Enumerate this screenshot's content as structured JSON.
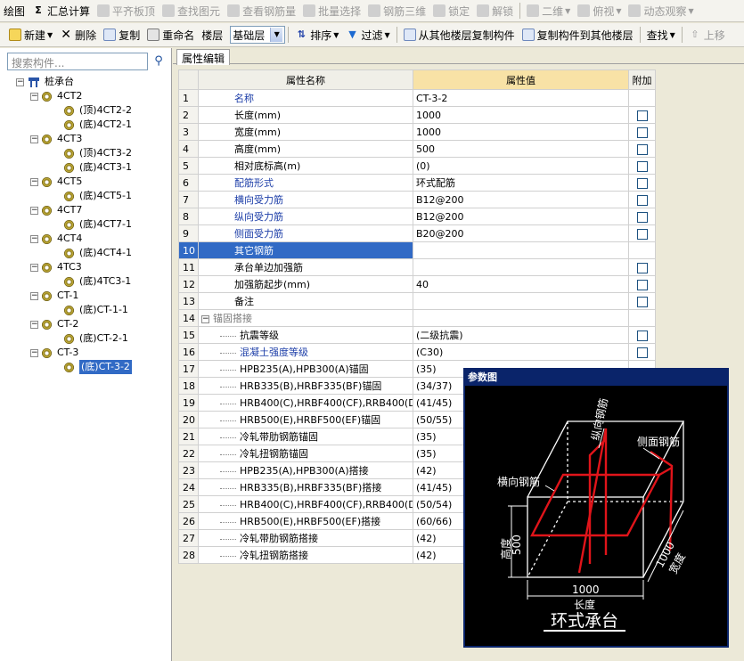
{
  "toolbar1": {
    "items": [
      {
        "label": "绘图",
        "enabled": true
      },
      {
        "label": "汇总计算",
        "enabled": true,
        "icon": "sigma-icon"
      },
      {
        "label": "平齐板顶",
        "enabled": false
      },
      {
        "label": "查找图元",
        "enabled": false
      },
      {
        "label": "查看钢筋量",
        "enabled": false
      },
      {
        "label": "批量选择",
        "enabled": false
      },
      {
        "label": "钢筋三维",
        "enabled": false
      },
      {
        "label": "锁定",
        "enabled": false
      },
      {
        "label": "解锁",
        "enabled": false
      },
      {
        "label": "二维",
        "enabled": false
      },
      {
        "label": "俯视",
        "enabled": false
      },
      {
        "label": "动态观察",
        "enabled": false
      }
    ]
  },
  "toolbar2": {
    "new_label": "新建",
    "delete_label": "删除",
    "copy_label": "复制",
    "rename_label": "重命名",
    "floor_label": "楼层",
    "floor_value": "基础层",
    "sort_label": "排序",
    "filter_label": "过滤",
    "copy_from_label": "从其他楼层复制构件",
    "copy_to_label": "复制构件到其他楼层",
    "find_label": "查找",
    "move_up_label": "上移"
  },
  "left": {
    "search_placeholder": "搜索构件...",
    "root": "桩承台",
    "groups": [
      {
        "name": "4CT2",
        "children": [
          "(顶)4CT2-2",
          "(底)4CT2-1"
        ]
      },
      {
        "name": "4CT3",
        "children": [
          "(顶)4CT3-2",
          "(底)4CT3-1"
        ]
      },
      {
        "name": "4CT5",
        "children": [
          "(底)4CT5-1"
        ]
      },
      {
        "name": "4CT7",
        "children": [
          "(底)4CT7-1"
        ]
      },
      {
        "name": "4CT4",
        "children": [
          "(底)4CT4-1"
        ]
      },
      {
        "name": "4TC3",
        "children": [
          "(底)4TC3-1"
        ]
      },
      {
        "name": "CT-1",
        "children": [
          "(底)CT-1-1"
        ]
      },
      {
        "name": "CT-2",
        "children": [
          "(底)CT-2-1"
        ]
      },
      {
        "name": "CT-3",
        "children": [
          "(底)CT-3-2"
        ]
      }
    ],
    "selected": "(底)CT-3-2"
  },
  "tab": {
    "label": "属性编辑"
  },
  "grid": {
    "headers": [
      "属性名称",
      "属性值",
      "附加"
    ],
    "rows": [
      {
        "n": "1",
        "name": "名称",
        "value": "CT-3-2",
        "style": "blue",
        "cb": false
      },
      {
        "n": "2",
        "name": "长度(mm)",
        "value": "1000",
        "style": "",
        "cb": true
      },
      {
        "n": "3",
        "name": "宽度(mm)",
        "value": "1000",
        "style": "",
        "cb": true
      },
      {
        "n": "4",
        "name": "高度(mm)",
        "value": "500",
        "style": "",
        "cb": true
      },
      {
        "n": "5",
        "name": "相对底标高(m)",
        "value": "(0)",
        "style": "",
        "cb": true
      },
      {
        "n": "6",
        "name": "配筋形式",
        "value": "环式配筋",
        "style": "blue",
        "cb": true
      },
      {
        "n": "7",
        "name": "横向受力筋",
        "value": "B12@200",
        "style": "blue",
        "cb": true
      },
      {
        "n": "8",
        "name": "纵向受力筋",
        "value": "B12@200",
        "style": "blue",
        "cb": true
      },
      {
        "n": "9",
        "name": "侧面受力筋",
        "value": "B20@200",
        "style": "blue",
        "cb": true
      },
      {
        "n": "10",
        "name": "其它钢筋",
        "value": "",
        "style": "selected",
        "cb": false
      },
      {
        "n": "11",
        "name": "承台单边加强筋",
        "value": "",
        "style": "",
        "cb": true
      },
      {
        "n": "12",
        "name": "加强筋起步(mm)",
        "value": "40",
        "style": "",
        "cb": true
      },
      {
        "n": "13",
        "name": "备注",
        "value": "",
        "style": "",
        "cb": true
      },
      {
        "n": "14",
        "name": "锚固搭接",
        "value": "",
        "style": "group",
        "cb": false
      },
      {
        "n": "15",
        "name": "抗震等级",
        "value": "(二级抗震)",
        "style": "sub",
        "cb": true
      },
      {
        "n": "16",
        "name": "混凝土强度等级",
        "value": "(C30)",
        "style": "sub-blue",
        "cb": true
      },
      {
        "n": "17",
        "name": "HPB235(A),HPB300(A)锚固",
        "value": "(35)",
        "style": "sub",
        "cb": false
      },
      {
        "n": "18",
        "name": "HRB335(B),HRBF335(BF)锚固",
        "value": "(34/37)",
        "style": "sub",
        "cb": false
      },
      {
        "n": "19",
        "name": "HRB400(C),HRBF400(CF),RRB400(D)锚",
        "value": "(41/45)",
        "style": "sub",
        "cb": false
      },
      {
        "n": "20",
        "name": "HRB500(E),HRBF500(EF)锚固",
        "value": "(50/55)",
        "style": "sub",
        "cb": false
      },
      {
        "n": "21",
        "name": "冷轧带肋钢筋锚固",
        "value": "(35)",
        "style": "sub",
        "cb": false
      },
      {
        "n": "22",
        "name": "冷轧扭钢筋锚固",
        "value": "(35)",
        "style": "sub",
        "cb": false
      },
      {
        "n": "23",
        "name": "HPB235(A),HPB300(A)搭接",
        "value": "(42)",
        "style": "sub",
        "cb": false
      },
      {
        "n": "24",
        "name": "HRB335(B),HRBF335(BF)搭接",
        "value": "(41/45)",
        "style": "sub",
        "cb": false
      },
      {
        "n": "25",
        "name": "HRB400(C),HRBF400(CF),RRB400(D)搭",
        "value": "(50/54)",
        "style": "sub",
        "cb": false
      },
      {
        "n": "26",
        "name": "HRB500(E),HRBF500(EF)搭接",
        "value": "(60/66)",
        "style": "sub",
        "cb": false
      },
      {
        "n": "27",
        "name": "冷轧带肋钢筋搭接",
        "value": "(42)",
        "style": "sub",
        "cb": false
      },
      {
        "n": "28",
        "name": "冷轧扭钢筋搭接",
        "value": "(42)",
        "style": "sub",
        "cb": false
      }
    ]
  },
  "popup": {
    "title": "参数图",
    "label_zongxiang": "纵向钢筋",
    "label_cemian": "侧面钢筋",
    "label_hengxiang": "横向钢筋",
    "label_height": "高度",
    "label_height_val": "500",
    "label_width": "宽度",
    "label_width_val": "1000",
    "label_length_val": "1000",
    "label_length": "长度",
    "caption": "环式承台"
  },
  "colors": {
    "selection": "#316ac5",
    "header_value": "#f8e2a6",
    "rebar": "#e0141a",
    "popup_title": "#0a246a"
  }
}
